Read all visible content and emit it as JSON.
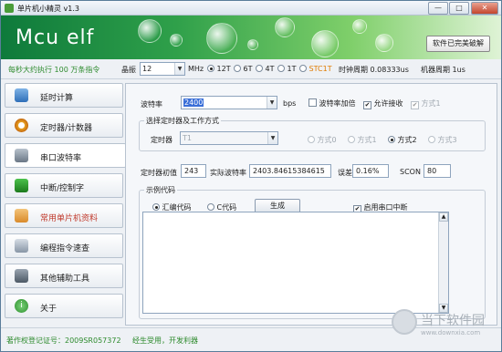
{
  "window": {
    "title": "单片机小精灵  v1.3",
    "min_label": "—",
    "max_label": "□",
    "close_label": "✕"
  },
  "banner": {
    "logo": "Mcu elf",
    "crack_button": "软件已完美破解"
  },
  "infobar": {
    "speed_text": "每秒大约执行 100 万条指令",
    "crystal_label": "晶振",
    "crystal_value": "12",
    "unit": "MHz",
    "modes": [
      {
        "label": "12T",
        "selected": true
      },
      {
        "label": "6T",
        "selected": false
      },
      {
        "label": "4T",
        "selected": false
      },
      {
        "label": "1T",
        "selected": false
      },
      {
        "label": "STC1T",
        "selected": false
      }
    ],
    "clock_period": "时钟周期 0.08333us",
    "machine_period": "机器周期 1us"
  },
  "sidebar": {
    "items": [
      {
        "label": "延时计算",
        "icon": "delay-calc-icon",
        "active": false
      },
      {
        "label": "定时器/计数器",
        "icon": "alarm-clock-icon",
        "active": false
      },
      {
        "label": "串口波特率",
        "icon": "serial-port-icon",
        "active": true
      },
      {
        "label": "中断/控制字",
        "icon": "chip-icon",
        "active": false
      },
      {
        "label": "常用单片机资料",
        "icon": "handshake-icon",
        "active": false
      },
      {
        "label": "编程指令速查",
        "icon": "keyboard-icon",
        "active": false
      },
      {
        "label": "其他辅助工具",
        "icon": "tools-icon",
        "active": false
      },
      {
        "label": "关于",
        "icon": "info-icon",
        "active": false
      }
    ]
  },
  "panel": {
    "baud_label": "波特率",
    "baud_value": "2400",
    "baud_unit": "bps",
    "double_baud": "波特率加倍",
    "allow_receive": "允许接收",
    "mode1_top": "方式1",
    "group_title": "选择定时器及工作方式",
    "timer_label": "定时器",
    "timer_value": "T1",
    "modes": [
      {
        "label": "方式0",
        "selected": false,
        "enabled": false
      },
      {
        "label": "方式1",
        "selected": false,
        "enabled": false
      },
      {
        "label": "方式2",
        "selected": true,
        "enabled": true
      },
      {
        "label": "方式3",
        "selected": false,
        "enabled": false
      }
    ],
    "init_label": "定时器初值",
    "init_value": "243",
    "actual_label": "实际波特率",
    "actual_value": "2403.84615384615",
    "error_label": "误差",
    "error_value": "0.16%",
    "scon_label": "SCON",
    "scon_value": "80",
    "example_title": "示例代码",
    "asm_label": "汇编代码",
    "c_label": "C代码",
    "generate_button": "生成",
    "enable_interrupt": "启用串口中断"
  },
  "status": {
    "cert": "著作权登记证号：2009SR057372",
    "slogan": "经生受用，开发利器"
  },
  "watermark": {
    "title": "当下软件园",
    "sub": "www.downxia.com"
  },
  "colors": {
    "banner_dark": "#0e7a3b",
    "banner_light": "#7fcf6a",
    "accent_orange": "#e07b00",
    "status_green": "#2e8b2e"
  }
}
